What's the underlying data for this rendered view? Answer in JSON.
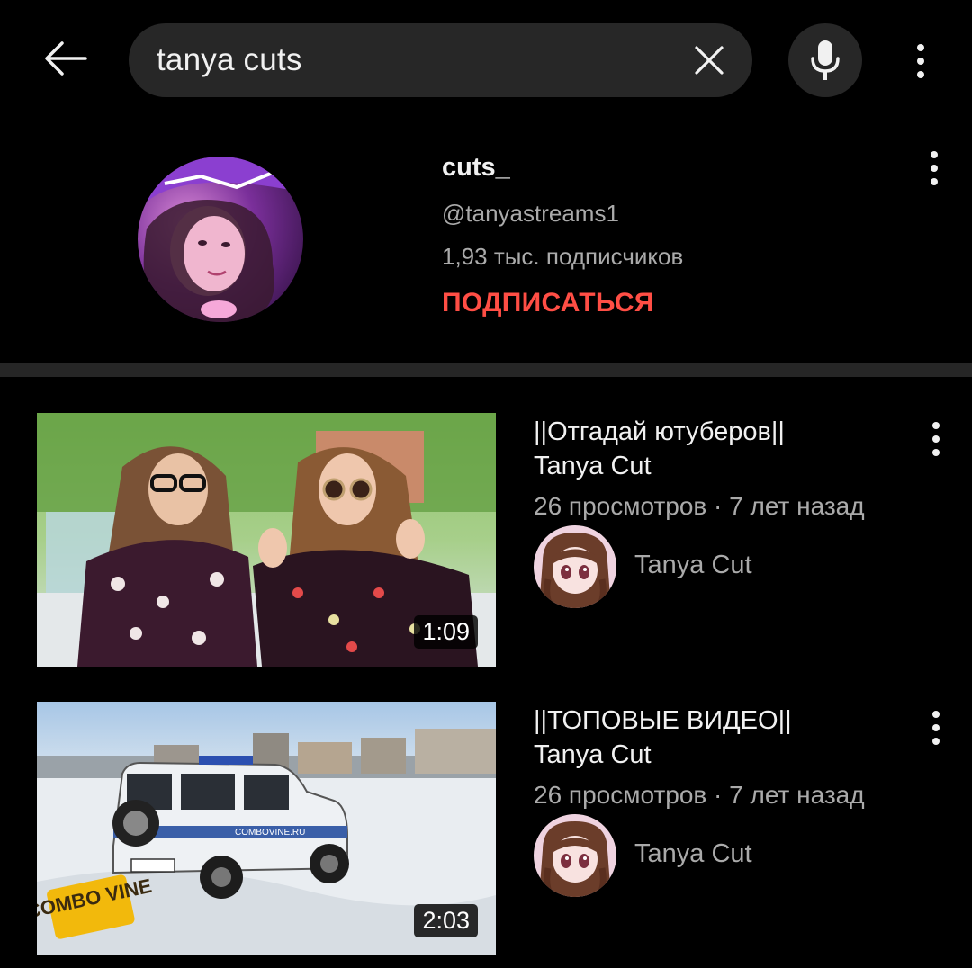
{
  "search": {
    "query": "tanya cuts"
  },
  "channel": {
    "name": "cuts_",
    "handle": "@tanyastreams1",
    "subscribers": "1,93 тыс. подписчиков",
    "subscribe_label": "ПОДПИСАТЬСЯ"
  },
  "videos": [
    {
      "title_line1": "||Отгадай ютуберов||",
      "title_line2": "Tanya Cut",
      "meta": "26 просмотров · 7 лет назад",
      "channel": "Tanya Cut",
      "duration": "1:09"
    },
    {
      "title_line1": "||ТОПОВЫЕ ВИДЕО||",
      "title_line2": "Tanya Cut",
      "meta": "26 просмотров · 7 лет назад",
      "channel": "Tanya Cut",
      "duration": "2:03",
      "watermark_logo": "COMBO VINE",
      "watermark_text": "COMBOVINE.RU"
    }
  ],
  "colors": {
    "background": "#000000",
    "search_bg": "#272727",
    "subscribe": "#ff4e45",
    "secondary_text": "#aaaaaa",
    "divider": "#262626"
  }
}
